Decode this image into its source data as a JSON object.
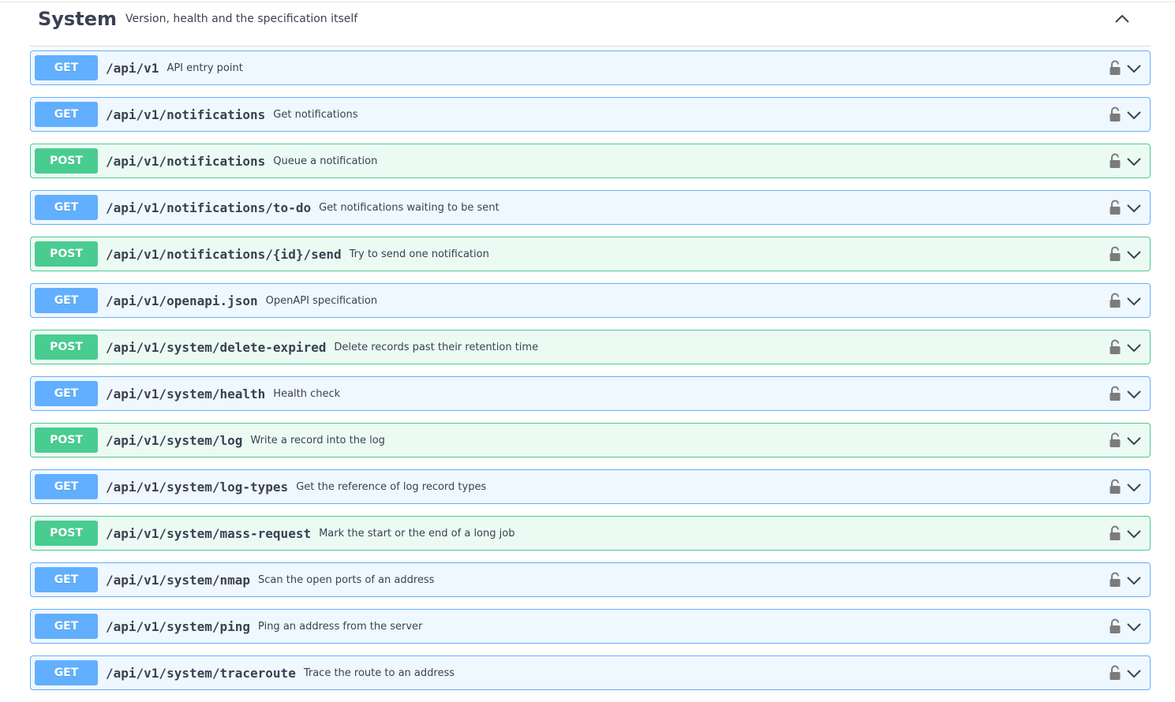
{
  "tag": {
    "name": "System",
    "description": "Version, health and the specification itself"
  },
  "operations": [
    {
      "method": "GET",
      "path": "/api/v1",
      "summary": "API entry point"
    },
    {
      "method": "GET",
      "path": "/api/v1/notifications",
      "summary": "Get notifications"
    },
    {
      "method": "POST",
      "path": "/api/v1/notifications",
      "summary": "Queue a notification"
    },
    {
      "method": "GET",
      "path": "/api/v1/notifications/to-do",
      "summary": "Get notifications waiting to be sent"
    },
    {
      "method": "POST",
      "path": "/api/v1/notifications/{id}/send",
      "summary": "Try to send one notification"
    },
    {
      "method": "GET",
      "path": "/api/v1/openapi.json",
      "summary": "OpenAPI specification"
    },
    {
      "method": "POST",
      "path": "/api/v1/system/delete-expired",
      "summary": "Delete records past their retention time"
    },
    {
      "method": "GET",
      "path": "/api/v1/system/health",
      "summary": "Health check"
    },
    {
      "method": "POST",
      "path": "/api/v1/system/log",
      "summary": "Write a record into the log"
    },
    {
      "method": "GET",
      "path": "/api/v1/system/log-types",
      "summary": "Get the reference of log record types"
    },
    {
      "method": "POST",
      "path": "/api/v1/system/mass-request",
      "summary": "Mark the start or the end of a long job"
    },
    {
      "method": "GET",
      "path": "/api/v1/system/nmap",
      "summary": "Scan the open ports of an address"
    },
    {
      "method": "GET",
      "path": "/api/v1/system/ping",
      "summary": "Ping an address from the server"
    },
    {
      "method": "GET",
      "path": "/api/v1/system/traceroute",
      "summary": "Trace the route to an address"
    }
  ],
  "icons": {
    "tag_toggle": "chevron-up-icon",
    "lock": "unlocked-padlock-icon",
    "expand": "chevron-down-icon"
  },
  "colors": {
    "get": "#61affe",
    "post": "#49cc90"
  }
}
